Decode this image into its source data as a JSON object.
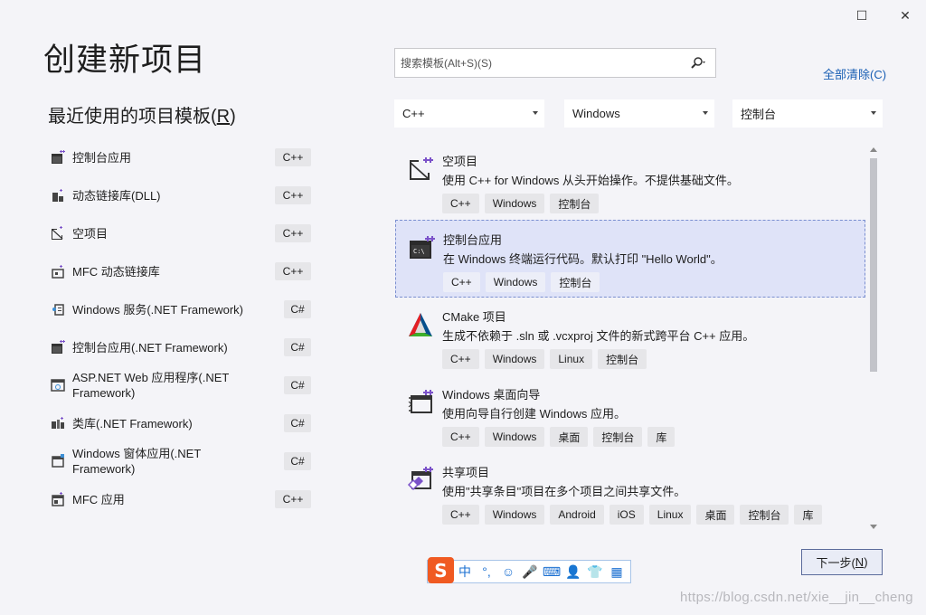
{
  "window": {
    "maximize_glyph": "☐",
    "close_glyph": "✕"
  },
  "page_title": "创建新项目",
  "recent": {
    "title": "最近使用的项目模板(",
    "title_key": "R",
    "title_end": ")",
    "items": [
      {
        "label": "控制台应用",
        "lang": "C++",
        "icon": "console-icon"
      },
      {
        "label": "动态链接库(DLL)",
        "lang": "C++",
        "icon": "dll-icon"
      },
      {
        "label": "空项目",
        "lang": "C++",
        "icon": "empty-project-icon"
      },
      {
        "label": "MFC 动态链接库",
        "lang": "C++",
        "icon": "mfc-dll-icon"
      },
      {
        "label": "Windows 服务(.NET Framework)",
        "lang": "C#",
        "icon": "service-icon"
      },
      {
        "label": "控制台应用(.NET Framework)",
        "lang": "C#",
        "icon": "console-icon"
      },
      {
        "label": "ASP.NET Web 应用程序(.NET Framework)",
        "lang": "C#",
        "icon": "web-app-icon"
      },
      {
        "label": "类库(.NET Framework)",
        "lang": "C#",
        "icon": "class-library-icon"
      },
      {
        "label": "Windows 窗体应用(.NET Framework)",
        "lang": "C#",
        "icon": "winforms-icon"
      },
      {
        "label": "MFC 应用",
        "lang": "C++",
        "icon": "mfc-app-icon"
      }
    ]
  },
  "search": {
    "placeholder": "搜索模板(Alt+S)(S)"
  },
  "clear_all": "全部清除(C)",
  "filters": {
    "language": "C++",
    "platform": "Windows",
    "project_type": "控制台"
  },
  "templates": [
    {
      "title": "空项目",
      "desc": "使用 C++ for Windows 从头开始操作。不提供基础文件。",
      "tags": [
        "C++",
        "Windows",
        "控制台"
      ],
      "icon": "empty-project-icon"
    },
    {
      "title": "控制台应用",
      "desc": "在 Windows 终端运行代码。默认打印 \"Hello World\"。",
      "tags": [
        "C++",
        "Windows",
        "控制台"
      ],
      "icon": "console-icon",
      "selected": true
    },
    {
      "title": "CMake 项目",
      "desc": "生成不依赖于 .sln 或 .vcxproj 文件的新式跨平台 C++ 应用。",
      "tags": [
        "C++",
        "Windows",
        "Linux",
        "控制台"
      ],
      "icon": "cmake-icon"
    },
    {
      "title": "Windows 桌面向导",
      "desc": "使用向导自行创建 Windows 应用。",
      "tags": [
        "C++",
        "Windows",
        "桌面",
        "控制台",
        "库"
      ],
      "icon": "desktop-wizard-icon"
    },
    {
      "title": "共享项目",
      "desc": "使用\"共享条目\"项目在多个项目之间共享文件。",
      "tags": [
        "C++",
        "Windows",
        "Android",
        "iOS",
        "Linux",
        "桌面",
        "控制台",
        "库"
      ],
      "icon": "shared-project-icon"
    }
  ],
  "next_button": {
    "label": "下一步(",
    "key": "N",
    "end": ")"
  },
  "ime": {
    "logo": "S",
    "items": [
      "中",
      "°,",
      "☺",
      "🎤",
      "⌨",
      "👤",
      "👕",
      "▦"
    ]
  },
  "watermark": "https://blog.csdn.net/xie__jin__cheng",
  "colors": {
    "accent": "#7b52c9",
    "link": "#1a5fb4",
    "selection": "#dfe3f8",
    "ime": "#f05a22"
  }
}
